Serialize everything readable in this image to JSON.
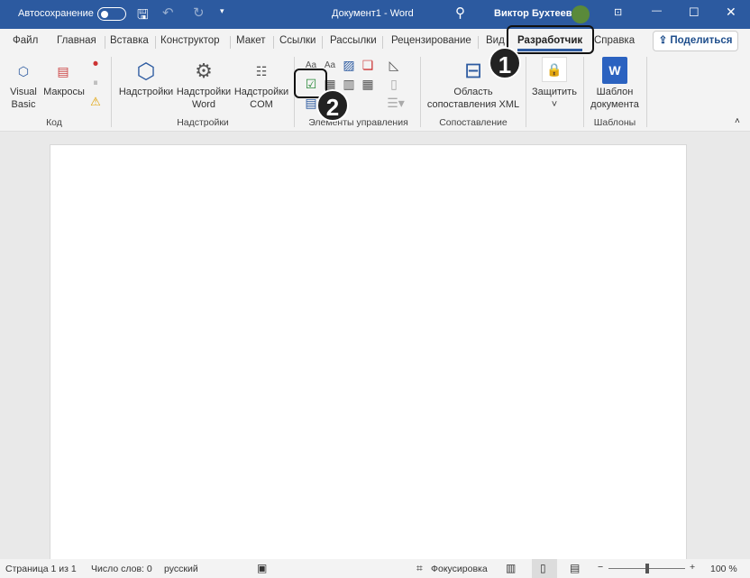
{
  "titlebar": {
    "autosave_label": "Автосохранение",
    "document_title": "Документ1  -  Word",
    "user_name": "Виктор Бухтеев"
  },
  "tabs": [
    "Файл",
    "Главная",
    "Вставка",
    "Конструктор",
    "Макет",
    "Ссылки",
    "Рассылки",
    "Рецензирование",
    "Вид",
    "Разработчик",
    "Справка"
  ],
  "share_label": "Поделиться",
  "ribbon": {
    "code": {
      "group": "Код",
      "visual_basic": "Visual Basic",
      "macros": "Макросы"
    },
    "addins": {
      "group": "Надстройки",
      "addins": "Надстройки",
      "word_addins": "Надстройки Word",
      "com_addins": "Надстройки COM"
    },
    "controls": {
      "group": "Элементы управления"
    },
    "mapping": {
      "group": "Сопоставление",
      "xml_pane": "Область сопоставления XML"
    },
    "protect": {
      "label": "Защитить"
    },
    "templates": {
      "group": "Шаблоны",
      "doc_template": "Шаблон документа"
    }
  },
  "callouts": [
    "1",
    "2"
  ],
  "status": {
    "page": "Страница 1 из 1",
    "words": "Число слов: 0",
    "language": "русский",
    "focus": "Фокусировка",
    "zoom": "100 %"
  }
}
